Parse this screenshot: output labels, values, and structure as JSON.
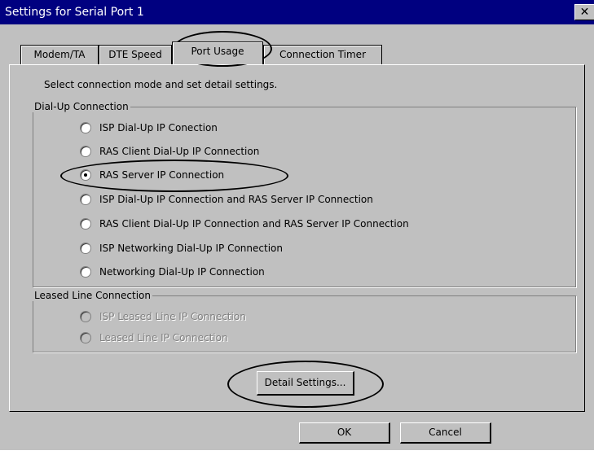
{
  "window": {
    "title": "Settings for Serial Port 1",
    "close_glyph": "✕"
  },
  "tabs": [
    {
      "label": "Modem/TA"
    },
    {
      "label": "DTE Speed"
    },
    {
      "label": "Port Usage",
      "active": true
    },
    {
      "label": "Connection Timer"
    }
  ],
  "instruction": "Select connection mode and set detail settings.",
  "dialup": {
    "label": "Dial-Up Connection",
    "options": [
      {
        "label": "ISP Dial-Up IP Conection",
        "checked": false
      },
      {
        "label": "RAS Client Dial-Up IP Connection",
        "checked": false
      },
      {
        "label": "RAS Server IP Connection",
        "checked": true
      },
      {
        "label": "ISP Dial-Up IP Connection and RAS Server IP Connection",
        "checked": false
      },
      {
        "label": "RAS Client Dial-Up IP Connection and RAS Server IP Connection",
        "checked": false
      },
      {
        "label": "ISP Networking Dial-Up IP Connection",
        "checked": false
      },
      {
        "label": "Networking Dial-Up IP Connection",
        "checked": false
      }
    ]
  },
  "leased": {
    "label": "Leased Line Connection",
    "options": [
      {
        "label": "ISP Leased Line IP Connection",
        "disabled": true
      },
      {
        "label": "Leased Line IP Connection",
        "disabled": true
      }
    ]
  },
  "buttons": {
    "detail": "Detail Settings...",
    "ok": "OK",
    "cancel": "Cancel"
  },
  "colors": {
    "dialog_bg": "#c0c0c0",
    "titlebar": "#000080",
    "annotation": "#000000"
  }
}
